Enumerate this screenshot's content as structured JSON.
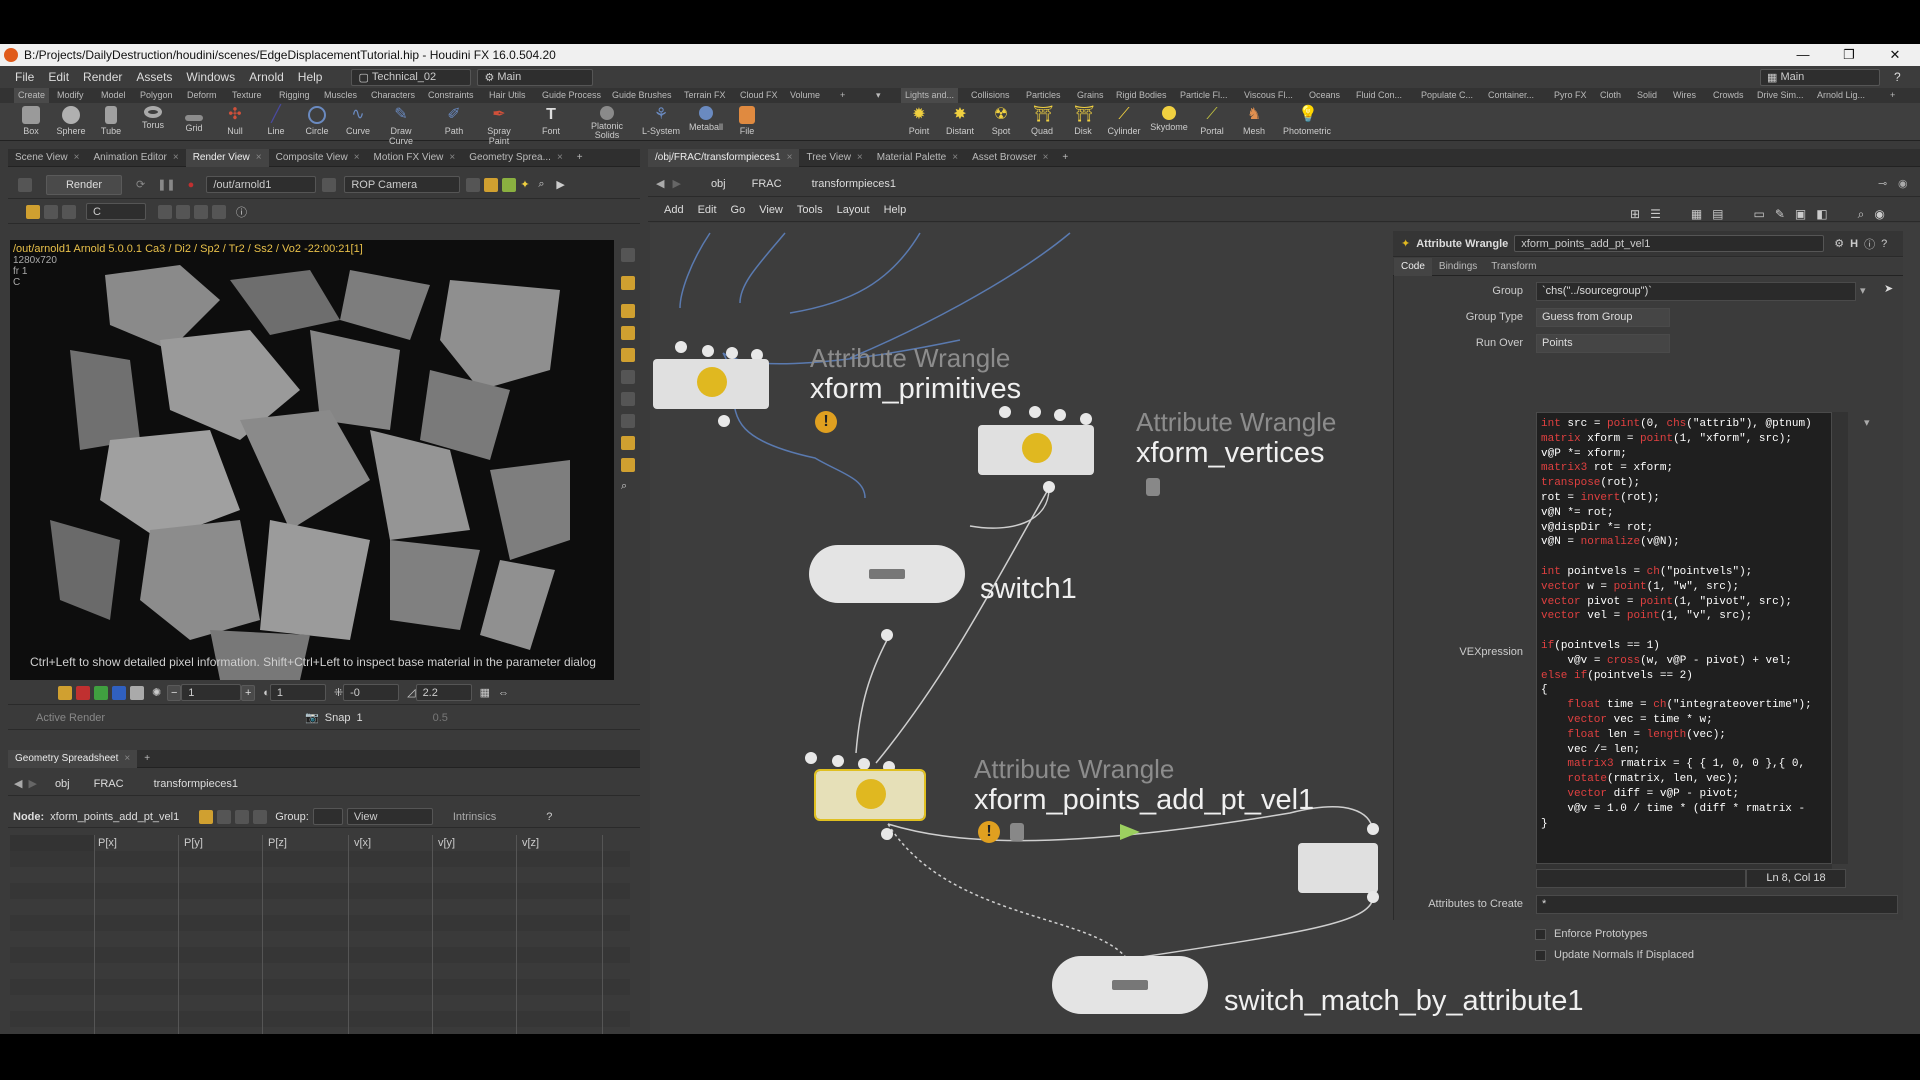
{
  "window": {
    "title": "B:/Projects/DailyDestruction/houdini/scenes/EdgeDisplacementTutorial.hip - Houdini FX 16.0.504.20",
    "controls": [
      "—",
      "❐",
      "✕"
    ]
  },
  "menubar": {
    "items": [
      "File",
      "Edit",
      "Render",
      "Assets",
      "Windows",
      "Arnold",
      "Help"
    ],
    "desktop": "Technical_02",
    "context": "Main",
    "right_context": "Main"
  },
  "shelf_tabs_left": [
    "Create",
    "Modify",
    "Model",
    "Polygon",
    "Deform",
    "Texture",
    "Rigging",
    "Muscles",
    "Characters",
    "Constraints",
    "Hair Utils",
    "Guide Process",
    "Guide Brushes",
    "Terrain FX",
    "Cloud FX",
    "Volume"
  ],
  "shelf_tabs_right": [
    "Lights and...",
    "Collisions",
    "Particles",
    "Grains",
    "Rigid Bodies",
    "Particle Fl...",
    "Viscous Fl...",
    "Oceans",
    "Fluid Con...",
    "Populate C...",
    "Container...",
    "Pyro FX",
    "Cloth",
    "Solid",
    "Wires",
    "Crowds",
    "Drive Sim...",
    "Arnold Lig..."
  ],
  "tools_left": [
    "Box",
    "Sphere",
    "Tube",
    "Torus",
    "Grid",
    "Null",
    "Line",
    "Circle",
    "Curve",
    "Draw Curve",
    "Path",
    "Spray Paint",
    "Font",
    "Platonic Solids",
    "L-System",
    "Metaball",
    "File"
  ],
  "tools_right": [
    "Point",
    "Distant",
    "Spot",
    "Quad",
    "Disk",
    "Cylinder",
    "Skydome",
    "Portal",
    "Mesh",
    "Photometric"
  ],
  "left_tabs": [
    "Scene View",
    "Animation Editor",
    "Render View",
    "Composite View",
    "Motion FX View",
    "Geometry Sprea..."
  ],
  "render_toolbar": {
    "render_button": "Render",
    "output": "/out/arnold1",
    "camera": "ROP Camera",
    "channel": "C"
  },
  "render_view": {
    "hud": "/out/arnold1   Arnold 5.0.0.1  Ca3 / Di2 / Sp2 / Tr2 / Ss2 / Vo2 -22:00:21[1]",
    "resolution": "1280x720",
    "frame": "fr 1",
    "channel": "C",
    "hint": "Ctrl+Left to show detailed pixel information. Shift+Ctrl+Left to inspect base material in the parameter dialog"
  },
  "render_bottom": {
    "field1": "1",
    "field2": "1",
    "field3": "-0",
    "field4": "2.2",
    "active_render": "Active Render",
    "snap": "Snap",
    "snap_value": "1",
    "value5": "0.5"
  },
  "sheet": {
    "tab": "Geometry Spreadsheet",
    "path": [
      "obj",
      "FRAC",
      "transformpieces1"
    ],
    "node_label": "Node:",
    "node": "xform_points_add_pt_vel1",
    "group_label": "Group:",
    "view": "View",
    "intrinsics": "Intrinsics",
    "columns": [
      "",
      "P[x]",
      "P[y]",
      "P[z]",
      "v[x]",
      "v[y]",
      "v[z]"
    ]
  },
  "right_tabs": [
    "/obj/FRAC/transformpieces1",
    "Tree View",
    "Material Palette",
    "Asset Browser"
  ],
  "network_path": [
    "obj",
    "FRAC",
    "transformpieces1"
  ],
  "network_menu": [
    "Add",
    "Edit",
    "Go",
    "View",
    "Tools",
    "Layout",
    "Help"
  ],
  "nodes": {
    "n1": {
      "type": "Attribute Wrangle",
      "name": "xform_primitives"
    },
    "n2": {
      "type": "Attribute Wrangle",
      "name": "xform_vertices"
    },
    "n3": {
      "name": "switch1"
    },
    "n4": {
      "type": "Attribute Wrangle",
      "name": "xform_points_add_pt_vel1"
    },
    "n5": {
      "name": "switch_match_by_attribute1"
    }
  },
  "params": {
    "header_type": "Attribute Wrangle",
    "header_name": "xform_points_add_pt_vel1",
    "tabs": [
      "Code",
      "Bindings",
      "Transform"
    ],
    "group_label": "Group",
    "group_value": "`chs(\"../sourcegroup\")`",
    "grouptype_label": "Group Type",
    "grouptype_value": "Guess from Group",
    "runover_label": "Run Over",
    "runover_value": "Points",
    "vex_label": "VEXpression",
    "code_lines": [
      "int src = point(0, chs(\"attrib\"), @ptnum)",
      "matrix xform = point(1, \"xform\", src);",
      "v@P *= xform;",
      "matrix3 rot = xform;",
      "transpose(rot);",
      "rot = invert(rot);",
      "v@N *= rot;",
      "v@dispDir *= rot;",
      "v@N = normalize(v@N);",
      "",
      "int pointvels = ch(\"pointvels\");",
      "vector w = point(1, \"w\", src);",
      "vector pivot = point(1, \"pivot\", src);",
      "vector vel = point(1, \"v\", src);",
      "",
      "if(pointvels == 1)",
      "    v@v = cross(w, v@P - pivot) + vel;",
      "else if(pointvels == 2)",
      "{",
      "    float time = ch(\"integrateovertime\");",
      "    vector vec = time * w;",
      "    float len = length(vec);",
      "    vec /= len;",
      "    matrix3 rmatrix = { { 1, 0, 0 },{ 0,",
      "    rotate(rmatrix, len, vec);",
      "    vector diff = v@P - pivot;",
      "    v@v = 1.0 / time * (diff * rmatrix -",
      "}"
    ],
    "cursor": "Ln 8, Col 18",
    "attrs_label": "Attributes to Create",
    "attrs_value": "*",
    "enforce": "Enforce Prototypes",
    "update_normals": "Update Normals If Displaced"
  }
}
